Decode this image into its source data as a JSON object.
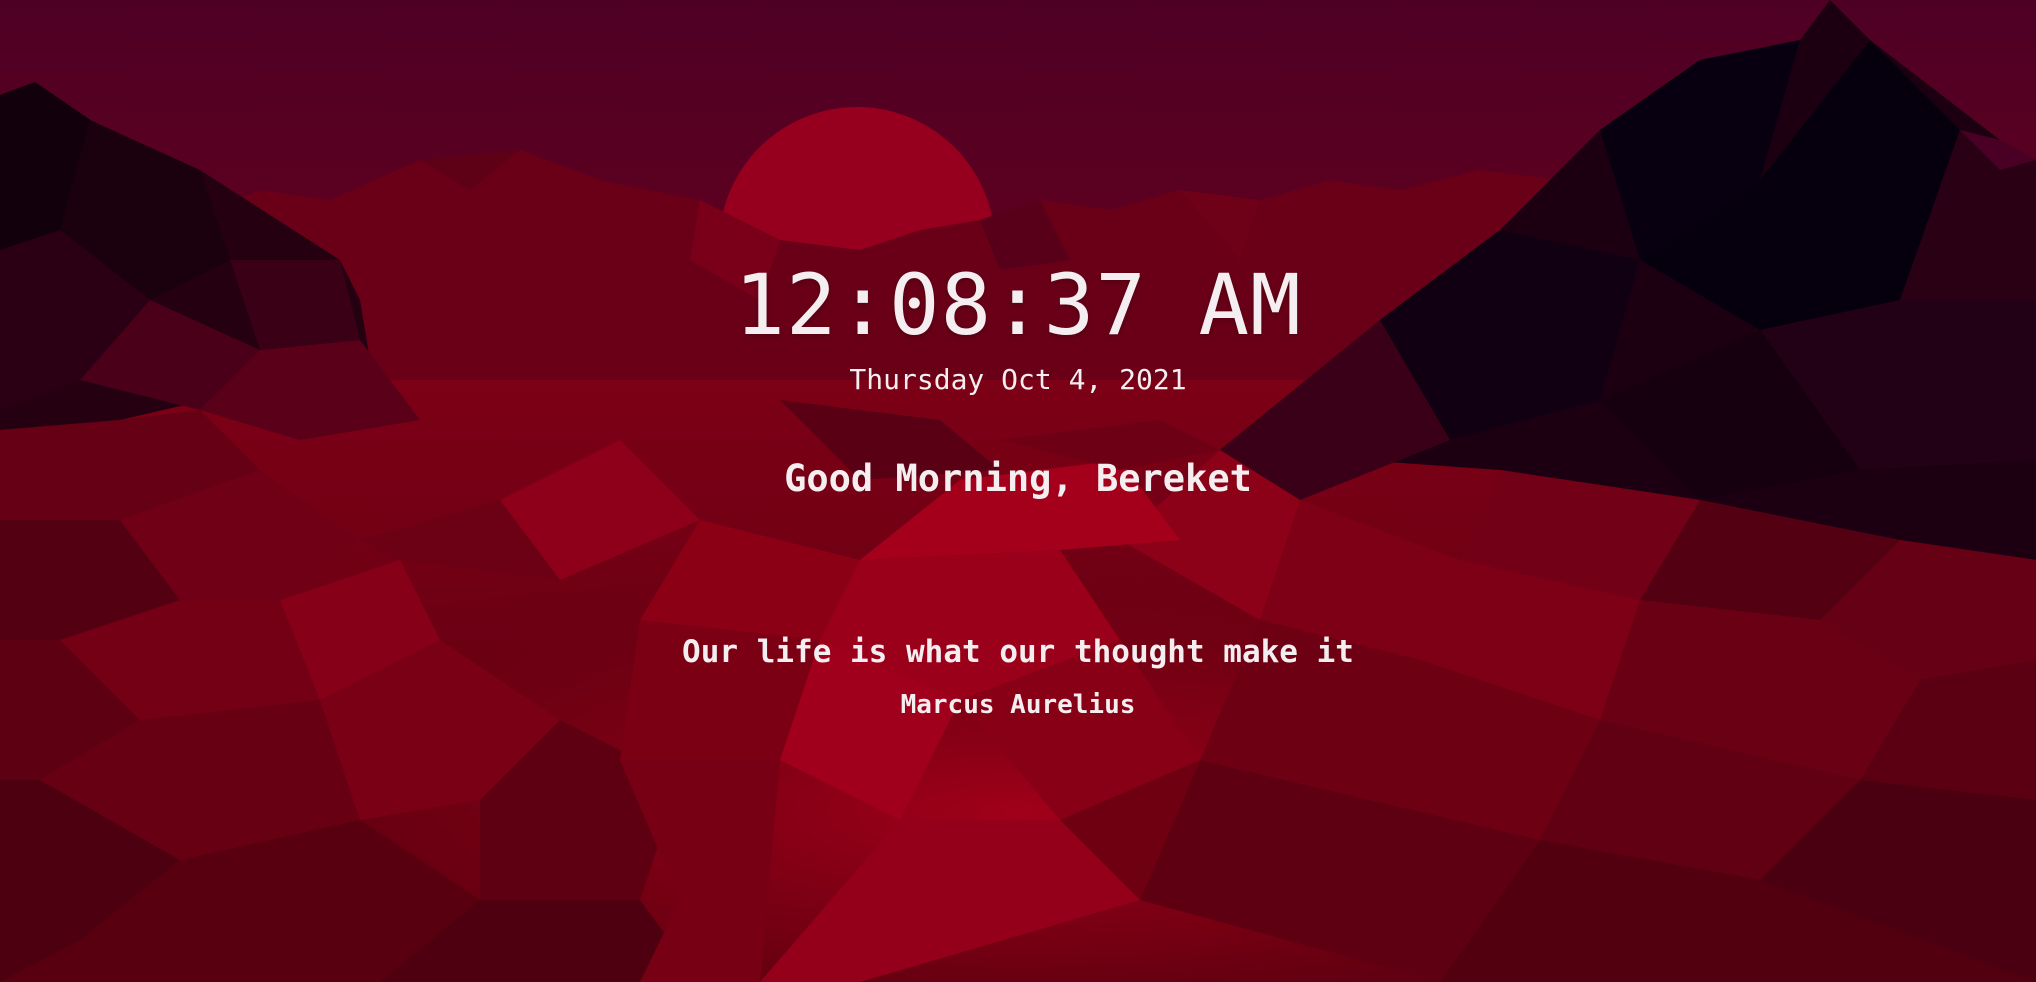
{
  "clock": {
    "time": "12:08:37 AM",
    "date": "Thursday Oct 4, 2021"
  },
  "greeting": {
    "text": "Good Morning, Bereket"
  },
  "quote": {
    "text": "Our life is what our thought make it",
    "author": "Marcus Aurelius"
  },
  "colors": {
    "sky_top": "#4e0024",
    "sky_horizon": "#7a0018",
    "sun": "#96001e",
    "ground": "#8a0012",
    "text": "#f4eef0"
  },
  "background": {
    "icon": "low-poly-mountains-wallpaper"
  }
}
